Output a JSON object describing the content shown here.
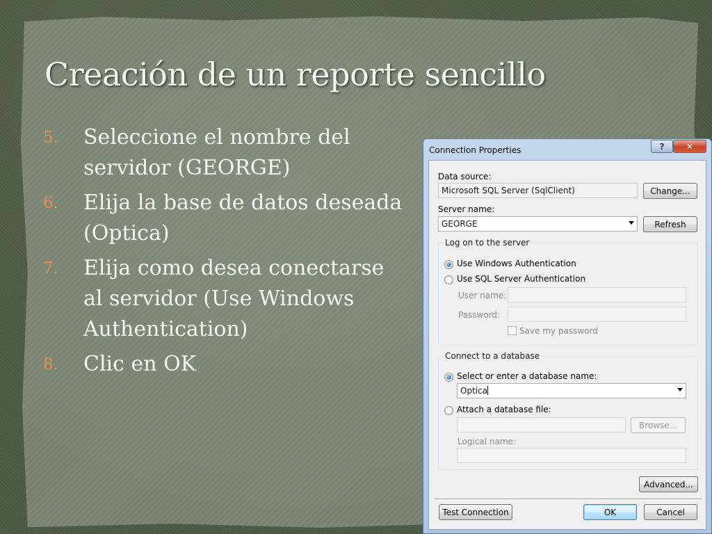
{
  "slide": {
    "title": "Creación de un reporte sencillo",
    "bullets": [
      {
        "num": "5.",
        "text": "Seleccione el nombre del servidor (GEORGE)"
      },
      {
        "num": "6.",
        "text": "Elija la base de datos deseada (Optica)"
      },
      {
        "num": "7.",
        "text": "Elija como desea conectarse al servidor (Use Windows Authentication)"
      },
      {
        "num": "8.",
        "text": "Clic en OK"
      }
    ]
  },
  "dialog": {
    "title": "Connection Properties",
    "help_label": "?",
    "close_label": "✕",
    "data_source_label": "Data source:",
    "data_source_value": "Microsoft SQL Server (SqlClient)",
    "change_label": "Change...",
    "server_name_label": "Server name:",
    "server_name_value": "GEORGE",
    "refresh_label": "Refresh",
    "logon_group": {
      "title": "Log on to the server",
      "windows_auth_label": "Use Windows Authentication",
      "sql_auth_label": "Use SQL Server Authentication",
      "user_name_label": "User name:",
      "password_label": "Password:",
      "save_password_label": "Save my password",
      "selected": "windows"
    },
    "database_group": {
      "title": "Connect to a database",
      "select_db_label": "Select or enter a database name:",
      "database_value": "Optica",
      "attach_label": "Attach a database file:",
      "browse_label": "Browse...",
      "logical_name_label": "Logical name:",
      "selected": "select"
    },
    "advanced_label": "Advanced...",
    "test_connection_label": "Test Connection",
    "ok_label": "OK",
    "cancel_label": "Cancel"
  },
  "colors": {
    "accent_number": "#e88f52",
    "slide_text": "#f6f6f2",
    "paper": "#7a8573"
  }
}
